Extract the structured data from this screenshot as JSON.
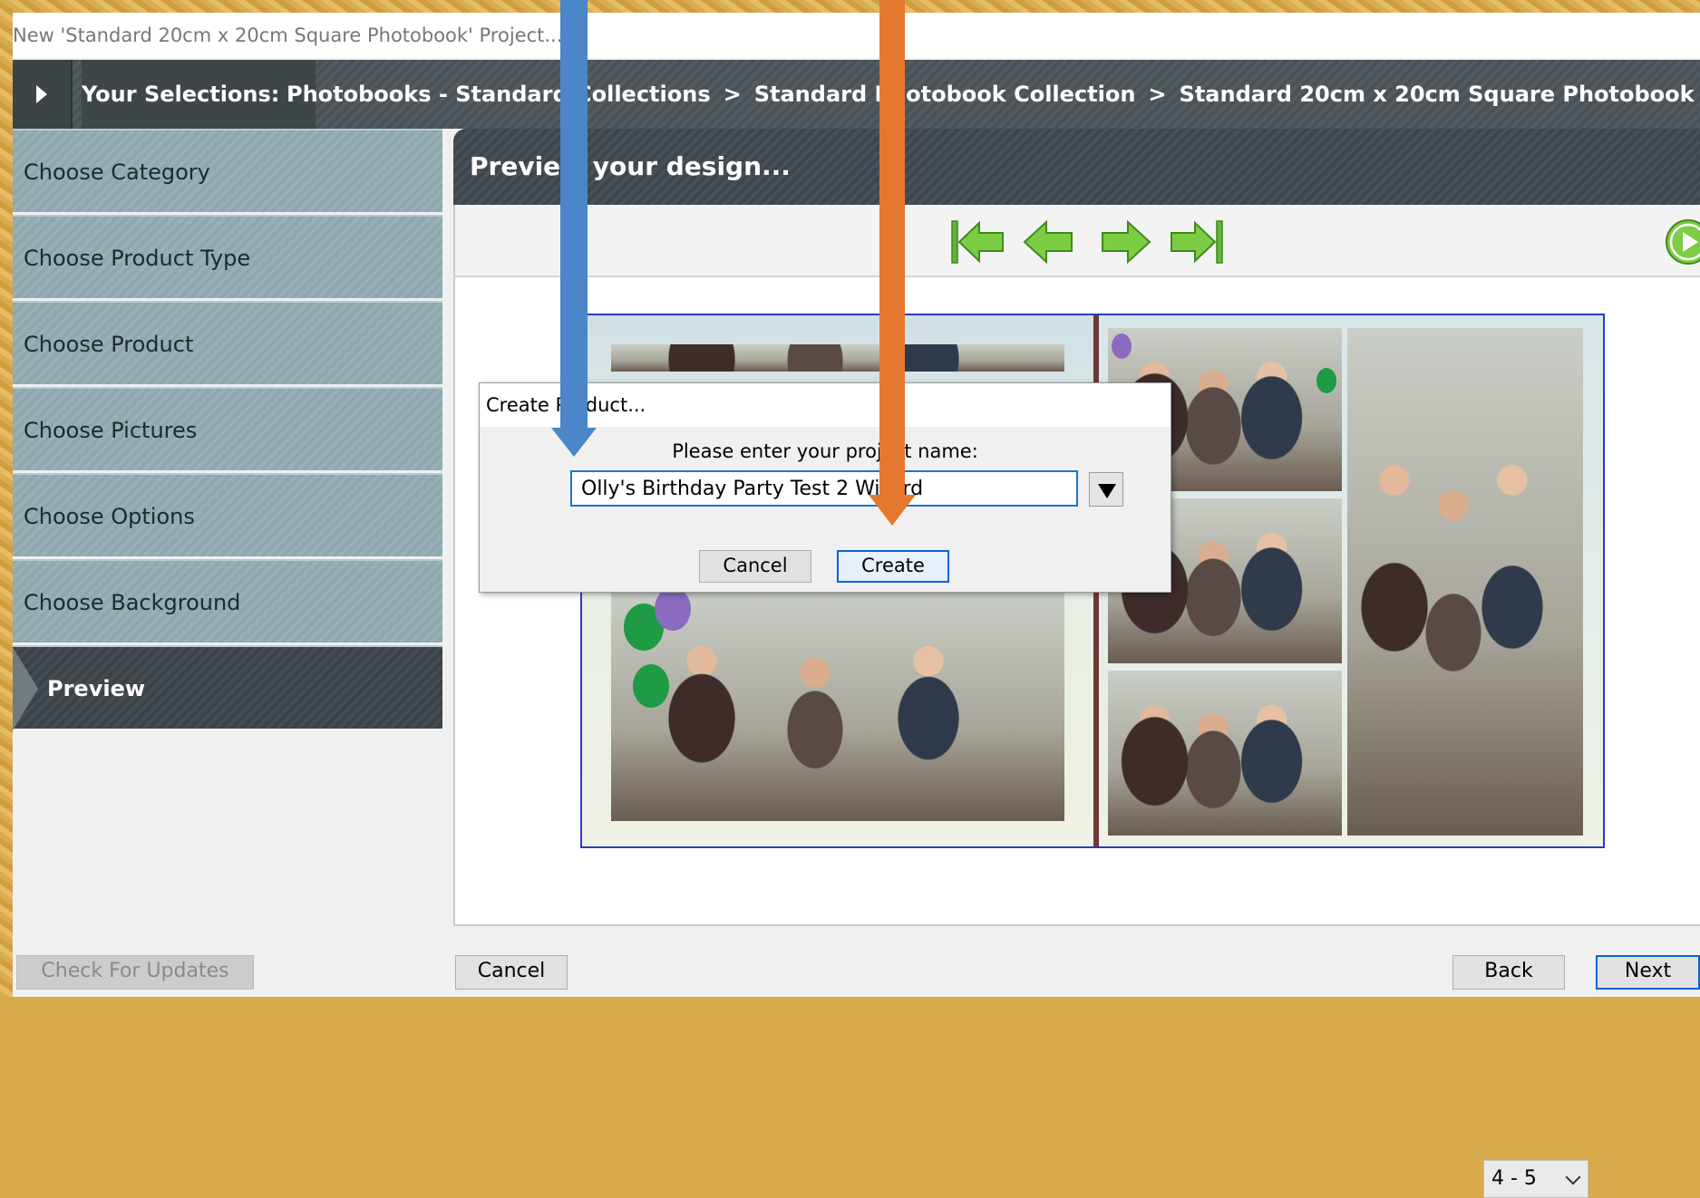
{
  "window": {
    "title": "New 'Standard 20cm x 20cm Square Photobook' Project..."
  },
  "breadcrumb": {
    "label": "Your Selections:",
    "items": [
      "Photobooks - Standard Collections",
      "Standard Photobook Collection",
      "Standard 20cm x 20cm Square Photobook"
    ],
    "separator": ">"
  },
  "sidebar": {
    "steps": [
      {
        "label": "Choose Category"
      },
      {
        "label": "Choose Product Type"
      },
      {
        "label": "Choose Product"
      },
      {
        "label": "Choose Pictures"
      },
      {
        "label": "Choose Options"
      },
      {
        "label": "Choose Background"
      },
      {
        "label": "Preview",
        "active": true
      }
    ],
    "check_updates": "Check For Updates"
  },
  "main": {
    "header": "Preview your design...",
    "page_select": "4 - 5"
  },
  "dialog": {
    "title": "Create Product...",
    "prompt": "Please enter your project name:",
    "input_value": "Olly's Birthday Party Test 2 Wizard",
    "cancel": "Cancel",
    "create": "Create"
  },
  "footer": {
    "cancel": "Cancel",
    "back": "Back",
    "next": "Next"
  },
  "colors": {
    "arrow_blue": "#4a86c8",
    "arrow_orange": "#e5782f",
    "nav_green": "#6fc23a",
    "spread_border": "#2b3cc7"
  }
}
